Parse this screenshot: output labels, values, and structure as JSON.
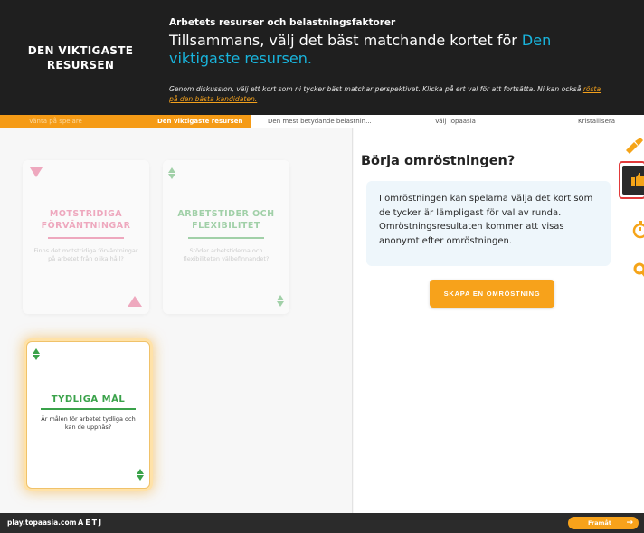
{
  "header": {
    "left_title_line1": "DEN VIKTIGASTE",
    "left_title_line2": "RESURSEN",
    "kicker": "Arbetets resurser och belastningsfaktorer",
    "title_prefix": "Tillsammans, välj det bäst matchande kortet för ",
    "title_accent": "Den viktigaste resursen.",
    "description": "Genom diskussion, välj ett kort som ni tycker bäst matchar perspektivet. Klicka på ert val för att fortsätta. Ni kan också ",
    "description_link": "rösta på den bästa kandidaten.",
    "colors": {
      "background": "#1f1f1f",
      "accent": "#19b4dc",
      "link": "#f2a01c"
    }
  },
  "steps": [
    {
      "label": "Vänta på spelare",
      "state": "done"
    },
    {
      "label": "Den viktigaste resursen",
      "state": "active"
    },
    {
      "label": "Den mest betydande belastnin...",
      "state": "todo"
    },
    {
      "label": "Välj Topaasia",
      "state": "todo"
    },
    {
      "label": "Kristallisera",
      "state": "todo"
    }
  ],
  "cards": [
    {
      "title_line1": "MOTSTRIDIGA",
      "title_line2": "FÖRVÄNTNINGAR",
      "text": "Finns det motstridiga förväntningar på arbetet från olika håll?",
      "icon": "triangle-icon",
      "color": "#e4497a"
    },
    {
      "title_line1": "ARBETSTIDER OCH",
      "title_line2": "FLEXIBILITET",
      "text": "Stöder arbetstiderna och flexibiliteten välbefinnandet?",
      "icon": "diamond-icon",
      "color": "#3aa24a"
    },
    {
      "title_line1": "TYDLIGA MÅL",
      "title_line2": "",
      "text": "Är målen för arbetet tydliga och kan de uppnås?",
      "icon": "diamond-icon",
      "color": "#3aa24a"
    }
  ],
  "vote_panel": {
    "title": "Börja omröstningen?",
    "info": "I omröstningen kan spelarna välja det kort som de tycker är lämpligast för val av runda. Omröstningsresultaten kommer att visas anonymt efter omröstningen.",
    "button_label": "SKAPA EN OMRÖSTNING",
    "accent": "#f7a21b"
  },
  "toolbar": {
    "tools": [
      "pencil-icon",
      "thumbs-up-icon",
      "timer-icon",
      "key-icon"
    ],
    "active": "thumbs-up-icon"
  },
  "footer": {
    "site": "play.topaasia.com",
    "brand": "AETJ",
    "next_label": "Framåt"
  }
}
